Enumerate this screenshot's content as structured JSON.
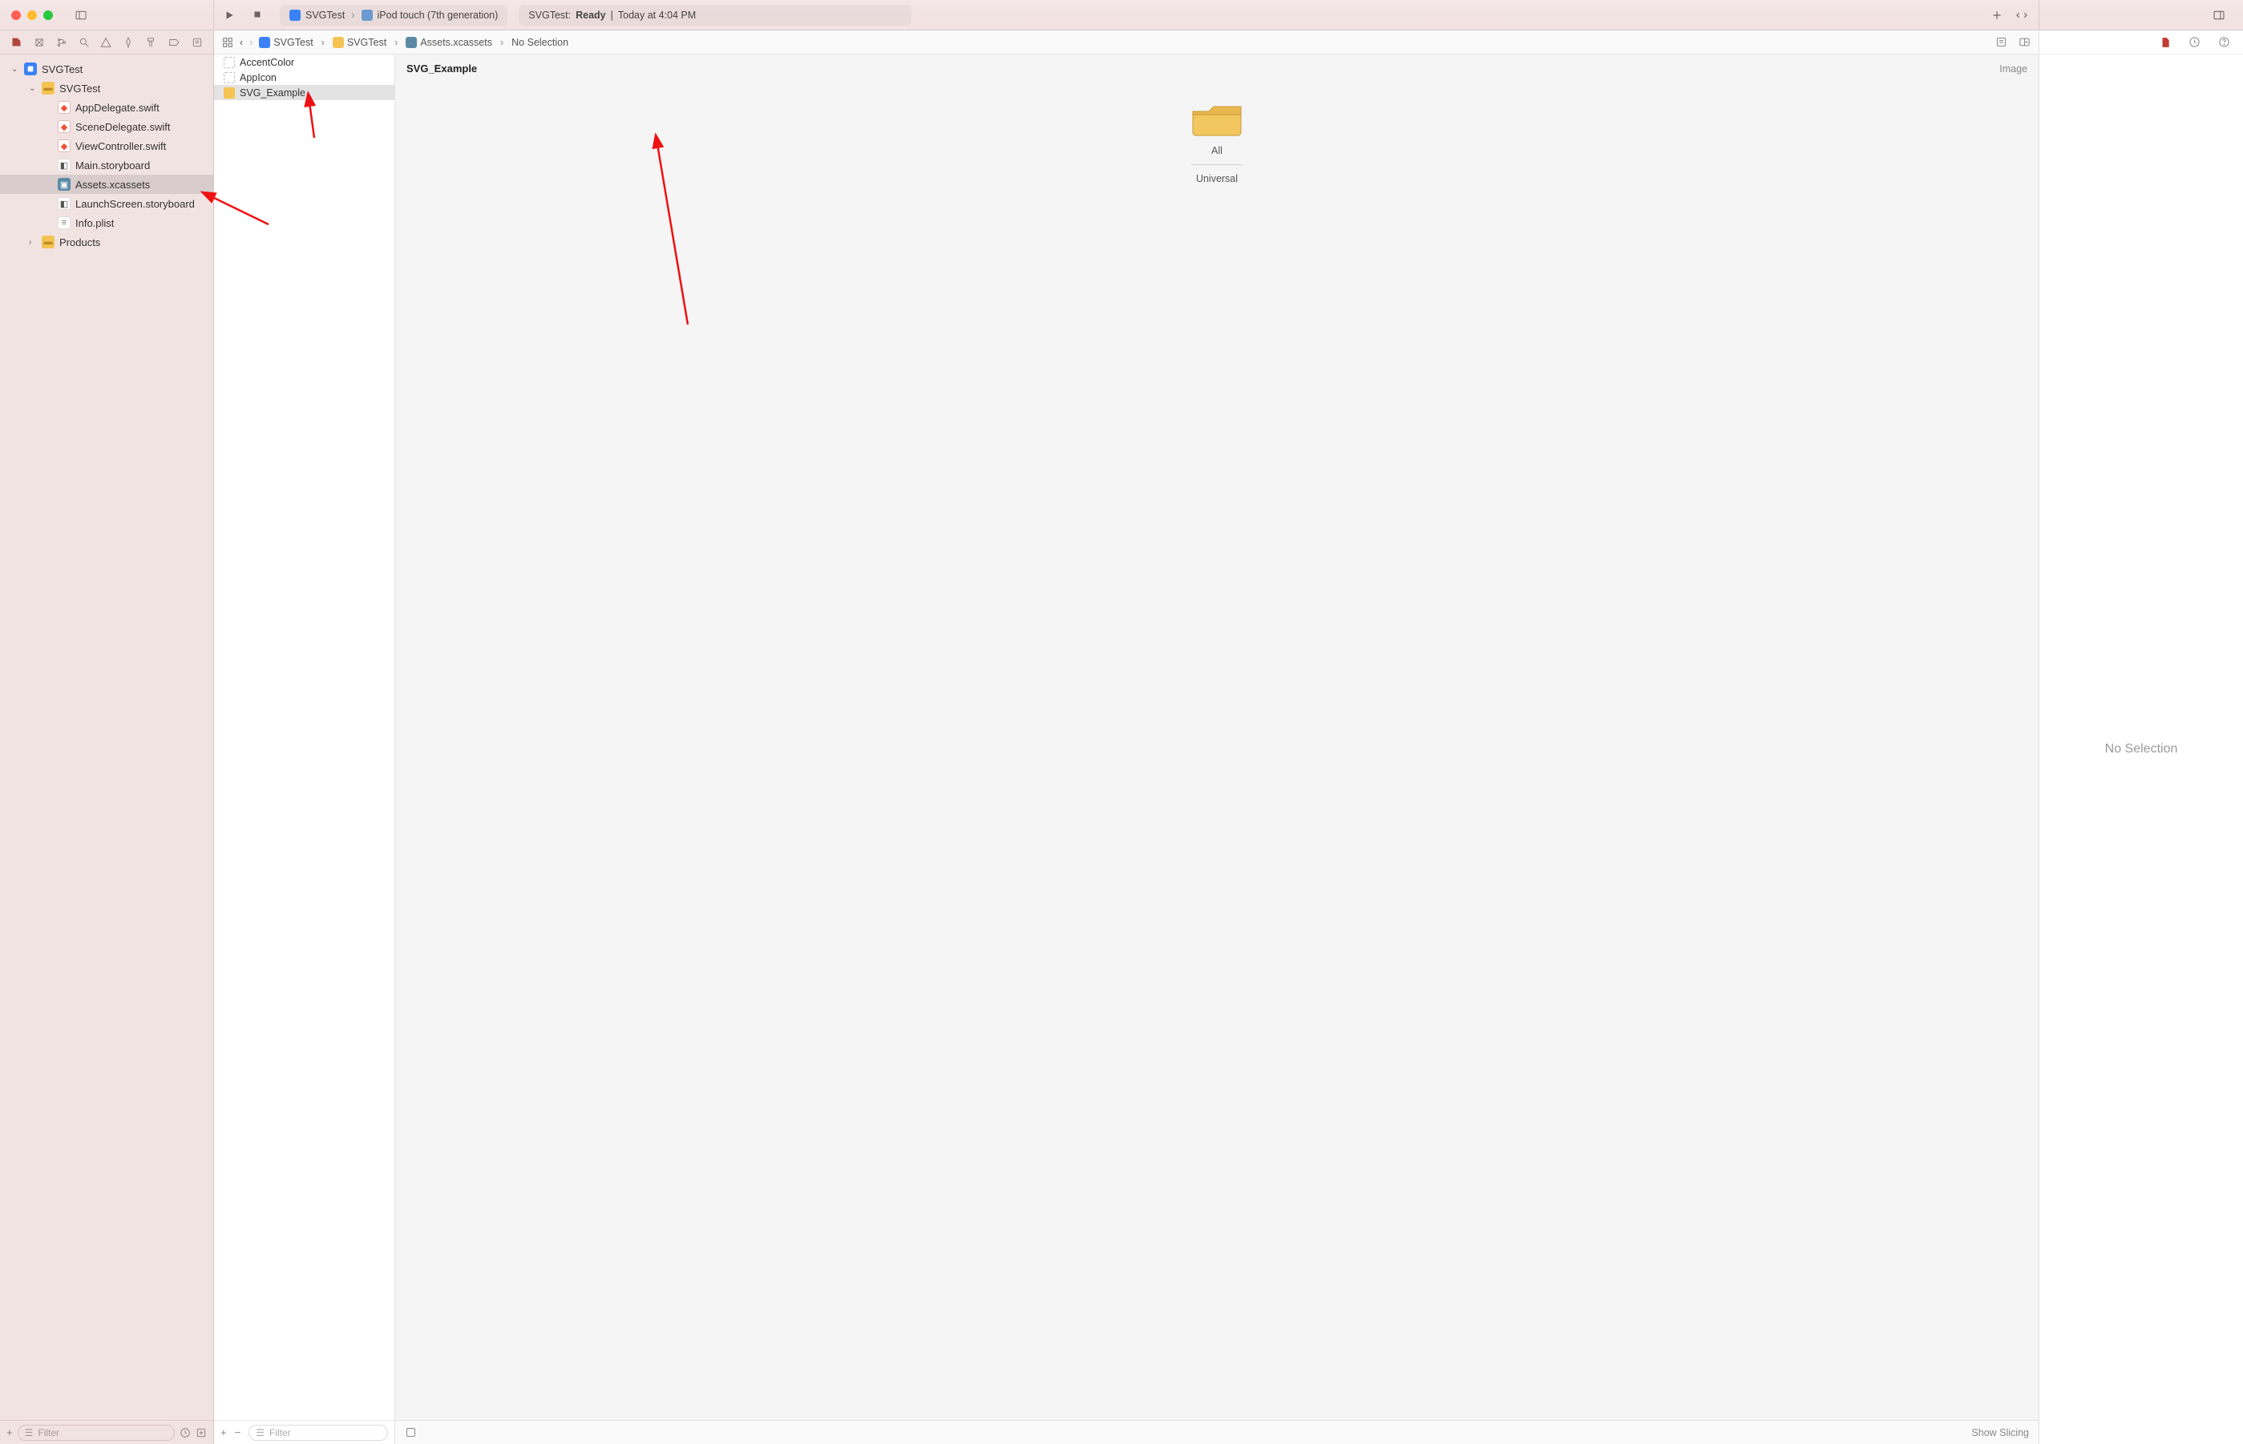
{
  "titlebar": {
    "scheme_project": "SVGTest",
    "scheme_device": "iPod touch (7th generation)",
    "status_project": "SVGTest:",
    "status_state": "Ready",
    "status_sep": "|",
    "status_time": "Today at 4:04 PM"
  },
  "navigator": {
    "filter_placeholder": "Filter",
    "tree": {
      "root": "SVGTest",
      "group": "SVGTest",
      "files": [
        "AppDelegate.swift",
        "SceneDelegate.swift",
        "ViewController.swift",
        "Main.storyboard",
        "Assets.xcassets",
        "LaunchScreen.storyboard",
        "Info.plist"
      ],
      "products": "Products"
    }
  },
  "jumpbar": {
    "c1": "SVGTest",
    "c2": "SVGTest",
    "c3": "Assets.xcassets",
    "c4": "No Selection"
  },
  "assets": {
    "items": [
      "AccentColor",
      "AppIcon",
      "SVG_Example"
    ],
    "filter_placeholder": "Filter"
  },
  "canvas": {
    "title": "SVG_Example",
    "type": "Image",
    "slot_label": "All",
    "slot_sub": "Universal",
    "show_slicing": "Show Slicing"
  },
  "inspector": {
    "empty": "No Selection"
  }
}
